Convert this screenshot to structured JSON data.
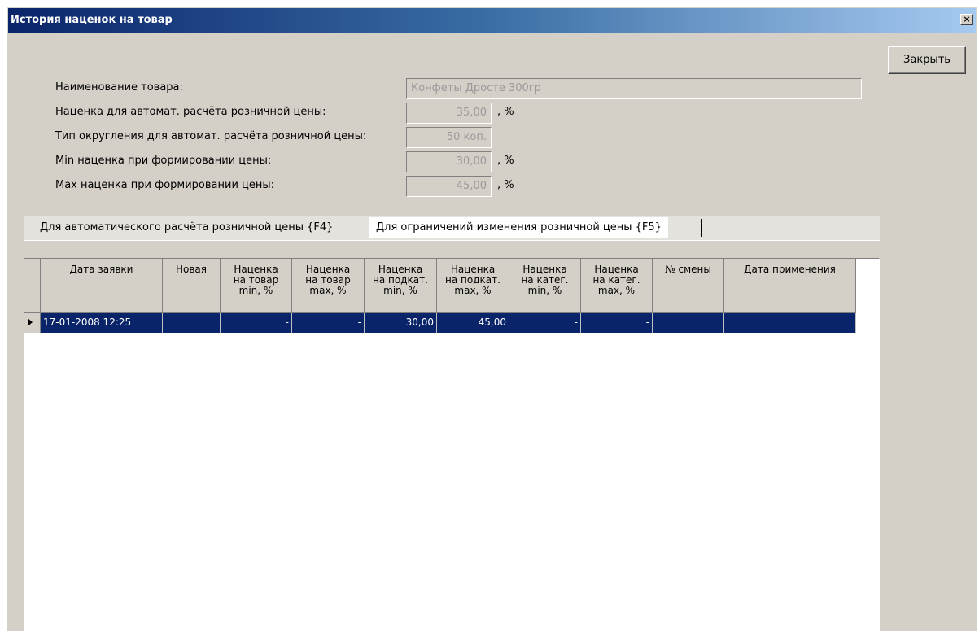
{
  "window": {
    "title": "История наценок на товар",
    "close_glyph": "×"
  },
  "buttons": {
    "close_label": "Закрыть"
  },
  "fields": {
    "name_label": "Наименование товара:",
    "name_value": "Конфеты Дросте 300гр",
    "auto_markup_label": "Наценка для автомат. расчёта розничной цены:",
    "auto_markup_value": "35,00",
    "rounding_label": "Тип округления для автомат. расчёта розничной цены:",
    "rounding_value": "50 коп.",
    "min_markup_label": "Min наценка при формировании цены:",
    "min_markup_value": "30,00",
    "max_markup_label": "Max наценка при формировании цены:",
    "max_markup_value": "45,00",
    "percent_unit": ", %"
  },
  "tabs": [
    {
      "label": "Для автоматического расчёта розничной цены {F4}"
    },
    {
      "label": "Для ограничений изменения розничной цены {F5}"
    }
  ],
  "table": {
    "headers": [
      "Дата заявки",
      "Новая",
      "Наценка\nна товар\nmin, %",
      "Наценка\nна товар\nmax, %",
      "Наценка\nна подкат.\nmin, %",
      "Наценка\nна подкат.\nmax, %",
      "Наценка\nна катег.\nmin, %",
      "Наценка\nна катег.\nmax, %",
      "№ смены",
      "Дата применения"
    ],
    "rows": [
      [
        "17-01-2008  12:25",
        "",
        "-",
        "-",
        "30,00",
        "45,00",
        "-",
        "-",
        "",
        ""
      ]
    ]
  },
  "colors": {
    "dialog_bg": "#d4d0c8",
    "title_gradient_start": "#0a246a",
    "title_gradient_end": "#a6caf0",
    "selection": "#0a246a",
    "disabled_text": "#9a9a9a"
  },
  "icons": {
    "row_indicator": "triangle-right-icon",
    "close": "close-icon"
  }
}
